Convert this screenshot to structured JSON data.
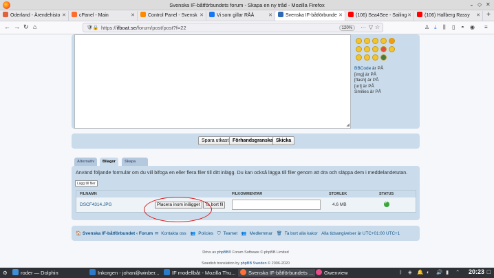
{
  "window": {
    "title": "Svenska IF-båtförbundets forum - Skapa en ny tråd - Mozilla Firefox"
  },
  "tabs": [
    {
      "label": "Oderland - Ärendehisto",
      "color": "#e0633a"
    },
    {
      "label": "cPanel - Main",
      "color": "#ff6c2c"
    },
    {
      "label": "Control Panel - Svensk",
      "color": "#ff8a00"
    },
    {
      "label": "Vi som gillar RÅÅ",
      "color": "#1877f2"
    },
    {
      "label": "Svenska IF-båtförbunde",
      "color": "#2d6ab4"
    },
    {
      "label": "(106) Sea4See - Sailing",
      "color": "#ff0000"
    },
    {
      "label": "(106) Hallberg Rassy",
      "color": "#ff0000"
    }
  ],
  "navbar": {
    "url_prefix": "https://",
    "url_domain": "ifboat.se",
    "url_path": "/forum/post/post?f=22",
    "zoom": "120%"
  },
  "editor": {
    "smilies_label": "smilies",
    "bbcode_link": "BBCode",
    "bbcode_state": " är PÅ",
    "img_line": "[img] är PÅ",
    "flash_line": "[flash] är PÅ",
    "url_line": "[url] är PÅ",
    "smilies_line": "Smilies är PÅ"
  },
  "submit": {
    "save_draft": "Spara utkast",
    "preview": "Förhandsgranska",
    "send": "Skicka"
  },
  "panel_tabs": {
    "options": "Alternativ",
    "attachments": "Bilagor",
    "poll": "Skapa omröstning"
  },
  "attachments": {
    "description": "Använd följande formulär om du vill bifoga en eller flera filer till ditt inlägg. Du kan också lägga till filer genom att dra och släppa dem i meddelandetutan.",
    "add_file": "Lägg till filer",
    "headers": {
      "filename": "FILNAMN",
      "comment": "FILKOMMENTAR",
      "size": "STORLEK",
      "status": "STATUS"
    },
    "file": {
      "name": "DSCF4314.JPG",
      "place_inline": "Placera inom inlägget",
      "delete": "Ta bort fil",
      "size": "4.6 MB"
    }
  },
  "footer": {
    "home": "Svenska IF-båtförbundet",
    "crumb": "Forum",
    "contact": "Kontakta oss",
    "policies": "Policies",
    "team": "Teamet",
    "members": "Medlemmar",
    "delete_cookies": "Ta bort alla kakor",
    "timezone": "Alla tidsangivelser är UTC+01:00 UTC+1"
  },
  "copyright": {
    "powered_prefix": "Drivs av ",
    "phpbb": "phpBB",
    "powered_suffix": "® Forum Software © phpBB Limited",
    "translation_prefix": "Swedish translation by ",
    "translation_link": "phpBB Sweden",
    "translation_suffix": " © 2006-2020"
  },
  "taskbar": {
    "items": [
      {
        "label": "roder — Dolphin",
        "color": "#3f8fd6"
      },
      {
        "label": "Inkorgen - johan@winber...",
        "color": "#2c7bc9"
      },
      {
        "label": "IF modellbåt - Mozilla Thu...",
        "color": "#2c7bc9"
      },
      {
        "label": "Svenska IF-båtförbundets ...",
        "color": "#ff7139"
      },
      {
        "label": "Gwenview",
        "color": "#e84c8a"
      }
    ],
    "clock": "20:23"
  }
}
